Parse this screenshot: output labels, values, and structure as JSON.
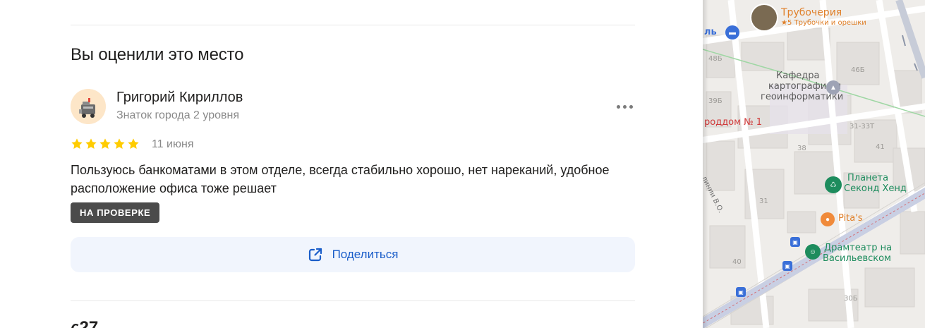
{
  "review_section": {
    "title": "Вы оценили это место",
    "author": {
      "name": "Григорий Кириллов",
      "level": "Знаток города 2 уровня"
    },
    "rating": 5,
    "date": "11 июня",
    "text": "Пользуюсь банкоматами в этом отделе, всегда стабильно хорошо, нет нареканий, удобное расположение офиса тоже решает",
    "status": "НА ПРОВЕРКЕ",
    "share_label": "Поделиться",
    "next_section_partial": "ς27"
  },
  "map": {
    "labels": {
      "trubocheria_title": "Трубочерия",
      "trubocheria_sub": "★5 Трубочки и орешки",
      "hotel_fragment": "ль",
      "kafedra_1": "Кафедра",
      "kafedra_2": "картографии и",
      "kafedra_3": "геоинформатики",
      "roddom": "роддом № 1",
      "planeta_1": "Планета",
      "planeta_2": "Секонд Хенд",
      "pitas": "Pita's",
      "dramteatr_1": "Драмтеатр на",
      "dramteatr_2": "Васильевском",
      "street": "линии В.О."
    },
    "numbers": {
      "n48b": "48Б",
      "n46b": "46Б",
      "n39b": "39Б",
      "n3133t": "31-33Т",
      "n38": "38",
      "n41": "41",
      "n31": "31",
      "n40": "40",
      "n30b": "30Б"
    }
  },
  "colors": {
    "accent_blue": "#1a5dc9",
    "star_yellow": "#fc0",
    "badge_bg": "#4b4b4b",
    "share_bg": "#f1f5fd"
  }
}
